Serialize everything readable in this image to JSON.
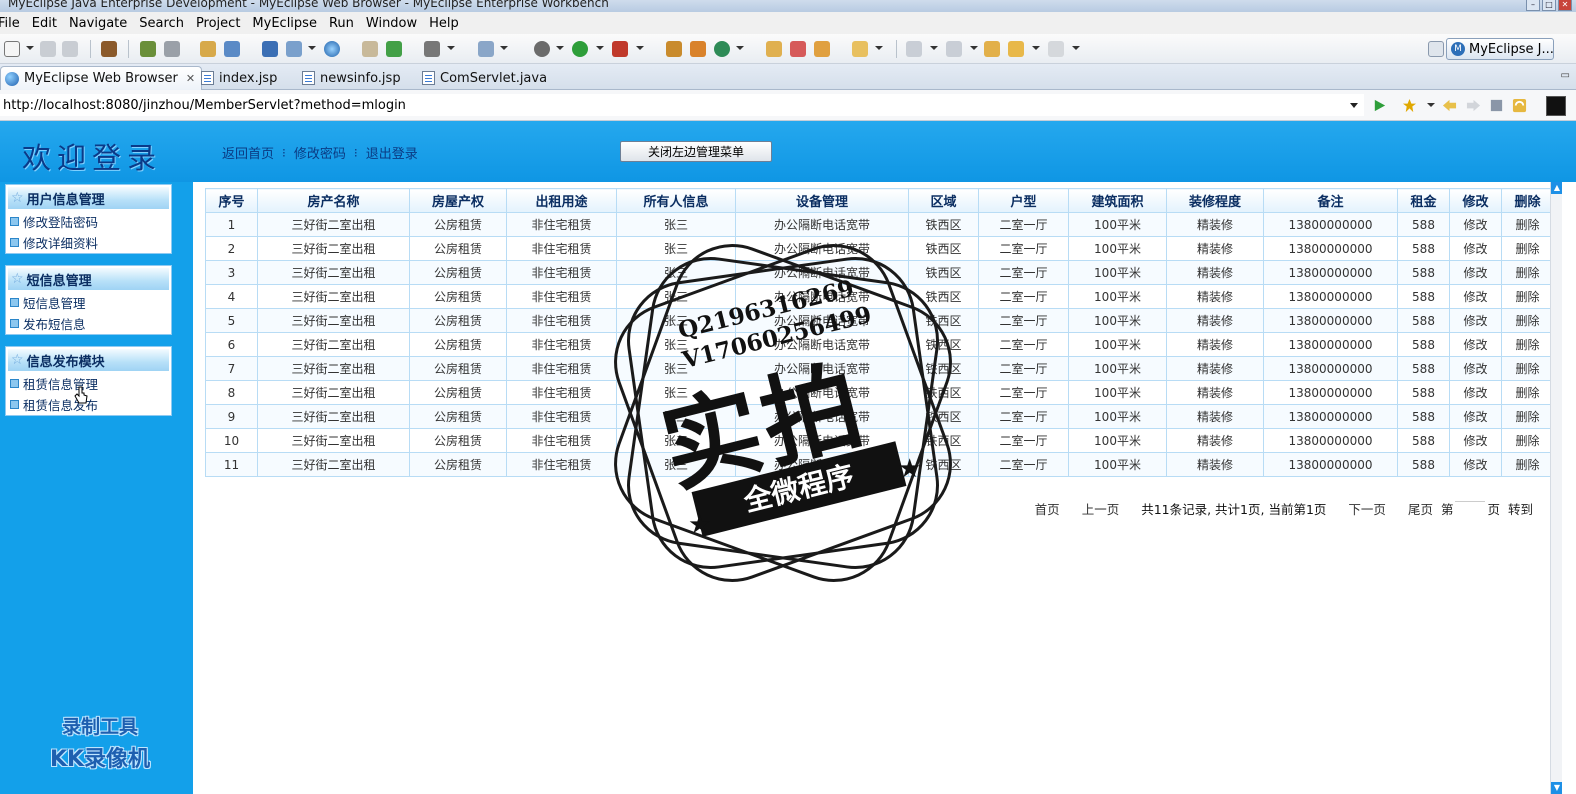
{
  "window": {
    "title": "MyEclipse Java Enterprise Development - MyEclipse Web Browser - MyEclipse Enterprise Workbench"
  },
  "menu": [
    "File",
    "Edit",
    "Navigate",
    "Search",
    "Project",
    "MyEclipse",
    "Run",
    "Window",
    "Help"
  ],
  "perspective": {
    "label": "MyEclipse J..."
  },
  "editor_tabs": [
    {
      "label": "MyEclipse Web Browser",
      "icon": "globe-icon",
      "active": true
    },
    {
      "label": "index.jsp",
      "icon": "jsp-file-icon",
      "active": false
    },
    {
      "label": "newsinfo.jsp",
      "icon": "jsp-file-icon",
      "active": false
    },
    {
      "label": "ComServlet.java",
      "icon": "java-file-icon",
      "active": false
    }
  ],
  "address": {
    "url": "http://localhost:8080/jinzhou/MemberServlet?method=mlogin"
  },
  "site": {
    "welcome": "欢迎登录",
    "header_links": [
      "返回首页",
      "修改密码",
      "退出登录"
    ],
    "close_menu_button": "关闭左边管理菜单"
  },
  "sidebar": {
    "groups": [
      {
        "title": "用户信息管理",
        "items": [
          "修改登陆密码",
          "修改详细资料"
        ]
      },
      {
        "title": "短信息管理",
        "items": [
          "短信息管理",
          "发布短信息"
        ]
      },
      {
        "title": "信息发布模块",
        "items": [
          "租赁信息管理",
          "租赁信息发布"
        ]
      }
    ]
  },
  "recorder_watermark": {
    "line1": "录制工具",
    "line2": "KK录像机"
  },
  "table": {
    "columns": [
      "序号",
      "房产名称",
      "房屋产权",
      "出租用途",
      "所有人信息",
      "设备管理",
      "区域",
      "户型",
      "建筑面积",
      "装修程度",
      "备注",
      "租金",
      "修改",
      "删除"
    ],
    "rows": [
      [
        "1",
        "三好街二室出租",
        "公房租赁",
        "非住宅租赁",
        "张三",
        "办公隔断电话宽带",
        "铁西区",
        "二室一厅",
        "100平米",
        "精装修",
        "13800000000",
        "588",
        "修改",
        "删除"
      ],
      [
        "2",
        "三好街二室出租",
        "公房租赁",
        "非住宅租赁",
        "张三",
        "办公隔断电话宽带",
        "铁西区",
        "二室一厅",
        "100平米",
        "精装修",
        "13800000000",
        "588",
        "修改",
        "删除"
      ],
      [
        "3",
        "三好街二室出租",
        "公房租赁",
        "非住宅租赁",
        "张三",
        "办公隔断电话宽带",
        "铁西区",
        "二室一厅",
        "100平米",
        "精装修",
        "13800000000",
        "588",
        "修改",
        "删除"
      ],
      [
        "4",
        "三好街二室出租",
        "公房租赁",
        "非住宅租赁",
        "张三",
        "办公隔断电话宽带",
        "铁西区",
        "二室一厅",
        "100平米",
        "精装修",
        "13800000000",
        "588",
        "修改",
        "删除"
      ],
      [
        "5",
        "三好街二室出租",
        "公房租赁",
        "非住宅租赁",
        "张三",
        "办公隔断电话宽带",
        "铁西区",
        "二室一厅",
        "100平米",
        "精装修",
        "13800000000",
        "588",
        "修改",
        "删除"
      ],
      [
        "6",
        "三好街二室出租",
        "公房租赁",
        "非住宅租赁",
        "张三",
        "办公隔断电话宽带",
        "铁西区",
        "二室一厅",
        "100平米",
        "精装修",
        "13800000000",
        "588",
        "修改",
        "删除"
      ],
      [
        "7",
        "三好街二室出租",
        "公房租赁",
        "非住宅租赁",
        "张三",
        "办公隔断电话宽带",
        "铁西区",
        "二室一厅",
        "100平米",
        "精装修",
        "13800000000",
        "588",
        "修改",
        "删除"
      ],
      [
        "8",
        "三好街二室出租",
        "公房租赁",
        "非住宅租赁",
        "张三",
        "办公隔断电话宽带",
        "铁西区",
        "二室一厅",
        "100平米",
        "精装修",
        "13800000000",
        "588",
        "修改",
        "删除"
      ],
      [
        "9",
        "三好街二室出租",
        "公房租赁",
        "非住宅租赁",
        "张三",
        "办公隔断电话宽带",
        "铁西区",
        "二室一厅",
        "100平米",
        "精装修",
        "13800000000",
        "588",
        "修改",
        "删除"
      ],
      [
        "10",
        "三好街二室出租",
        "公房租赁",
        "非住宅租赁",
        "张三",
        "办公隔断电话宽带",
        "铁西区",
        "二室一厅",
        "100平米",
        "精装修",
        "13800000000",
        "588",
        "修改",
        "删除"
      ],
      [
        "11",
        "三好街二室出租",
        "公房租赁",
        "非住宅租赁",
        "张三",
        "办公隔断电话宽带",
        "铁西区",
        "二室一厅",
        "100平米",
        "精装修",
        "13800000000",
        "588",
        "修改",
        "删除"
      ]
    ]
  },
  "pager": {
    "first": "首页",
    "prev": "上一页",
    "info": "共11条记录, 共计1页, 当前第1页",
    "next": "下一页",
    "last": "尾页",
    "page_prefix": "第",
    "page_suffix": "页",
    "goto": "转到"
  },
  "stamp": {
    "line1": "Q2196316269",
    "line2": "V17060256499",
    "main": "实拍",
    "ribbon": "全微程序"
  },
  "colors": {
    "header_blue": "#1aa3ec",
    "sidebar_blue": "#13a0ea",
    "link_navy": "#0b3b83"
  }
}
